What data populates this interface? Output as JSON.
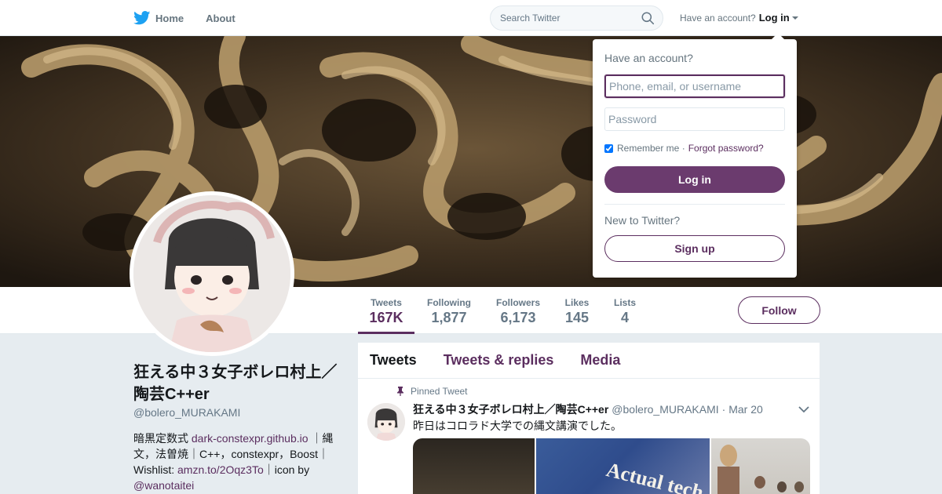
{
  "nav": {
    "home_label": "Home",
    "about_label": "About",
    "search_placeholder": "Search Twitter",
    "have_account_text": "Have an account?",
    "login_label": "Log in"
  },
  "profile": {
    "name": "狂える中３女子ボレロ村上／陶芸C++er",
    "handle": "@bolero_MURAKAMI",
    "bio": {
      "part1": "暗黒定数式 ",
      "link1": "dark-constexpr.github.io",
      "part2": " ｜縄文，法曽焼｜C++，constexpr，Boost｜Wishlist: ",
      "link2": "amzn.to/2Oqz3To",
      "part3": "｜icon by ",
      "link3": "@wanotaitei"
    }
  },
  "stats": [
    {
      "label": "Tweets",
      "value": "167K"
    },
    {
      "label": "Following",
      "value": "1,877"
    },
    {
      "label": "Followers",
      "value": "6,173"
    },
    {
      "label": "Likes",
      "value": "145"
    },
    {
      "label": "Lists",
      "value": "4"
    }
  ],
  "follow_label": "Follow",
  "timeline": {
    "tabs": [
      "Tweets",
      "Tweets & replies",
      "Media"
    ],
    "pinned_label": "Pinned Tweet",
    "tweet": {
      "name": "狂える中３女子ボレロ村上／陶芸C++er",
      "handle": "@bolero_MURAKAMI",
      "date": "· Mar 20",
      "text": "昨日はコロラド大学での縄文講演でした。",
      "media_text": "Actual tech"
    }
  },
  "login_dropdown": {
    "title": "Have an account?",
    "username_placeholder": "Phone, email, or username",
    "password_placeholder": "Password",
    "remember_label": "Remember me ·",
    "remember_checked": true,
    "forgot_label": "Forgot password?",
    "login_button": "Log in",
    "new_label": "New to Twitter?",
    "signup_button": "Sign up"
  },
  "colors": {
    "accent": "#5b2e5f",
    "login_button": "#6b3b6e",
    "twitter_blue": "#1da1f2"
  },
  "icons": [
    "twitter-bird-icon",
    "search-icon",
    "caret-down-icon",
    "pin-icon",
    "chevron-down-icon"
  ]
}
